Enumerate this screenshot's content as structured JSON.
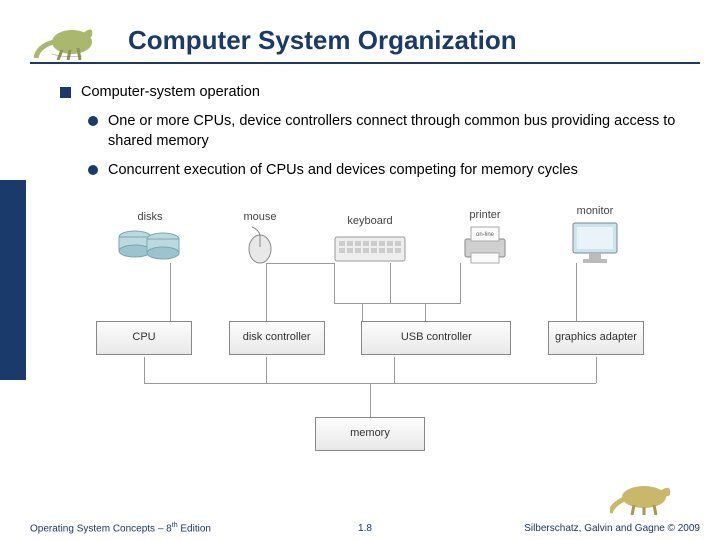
{
  "header": {
    "title": "Computer System Organization"
  },
  "bullets": {
    "main": "Computer-system operation",
    "sub1": "One or more CPUs, device controllers connect through common bus providing access to shared memory",
    "sub2": "Concurrent execution of CPUs and devices competing for memory cycles"
  },
  "diagram": {
    "devices": {
      "disks": "disks",
      "mouse": "mouse",
      "keyboard": "keyboard",
      "printer": "printer",
      "monitor": "monitor",
      "online": "on-line"
    },
    "controllers": {
      "cpu": "CPU",
      "disk": "disk controller",
      "usb": "USB controller",
      "graphics": "graphics adapter"
    },
    "memory": "memory"
  },
  "footer": {
    "left_a": "Operating System Concepts – 8",
    "left_b": " Edition",
    "left_sup": "th",
    "mid": "1.8",
    "right": "Silberschatz, Galvin and Gagne © 2009"
  }
}
